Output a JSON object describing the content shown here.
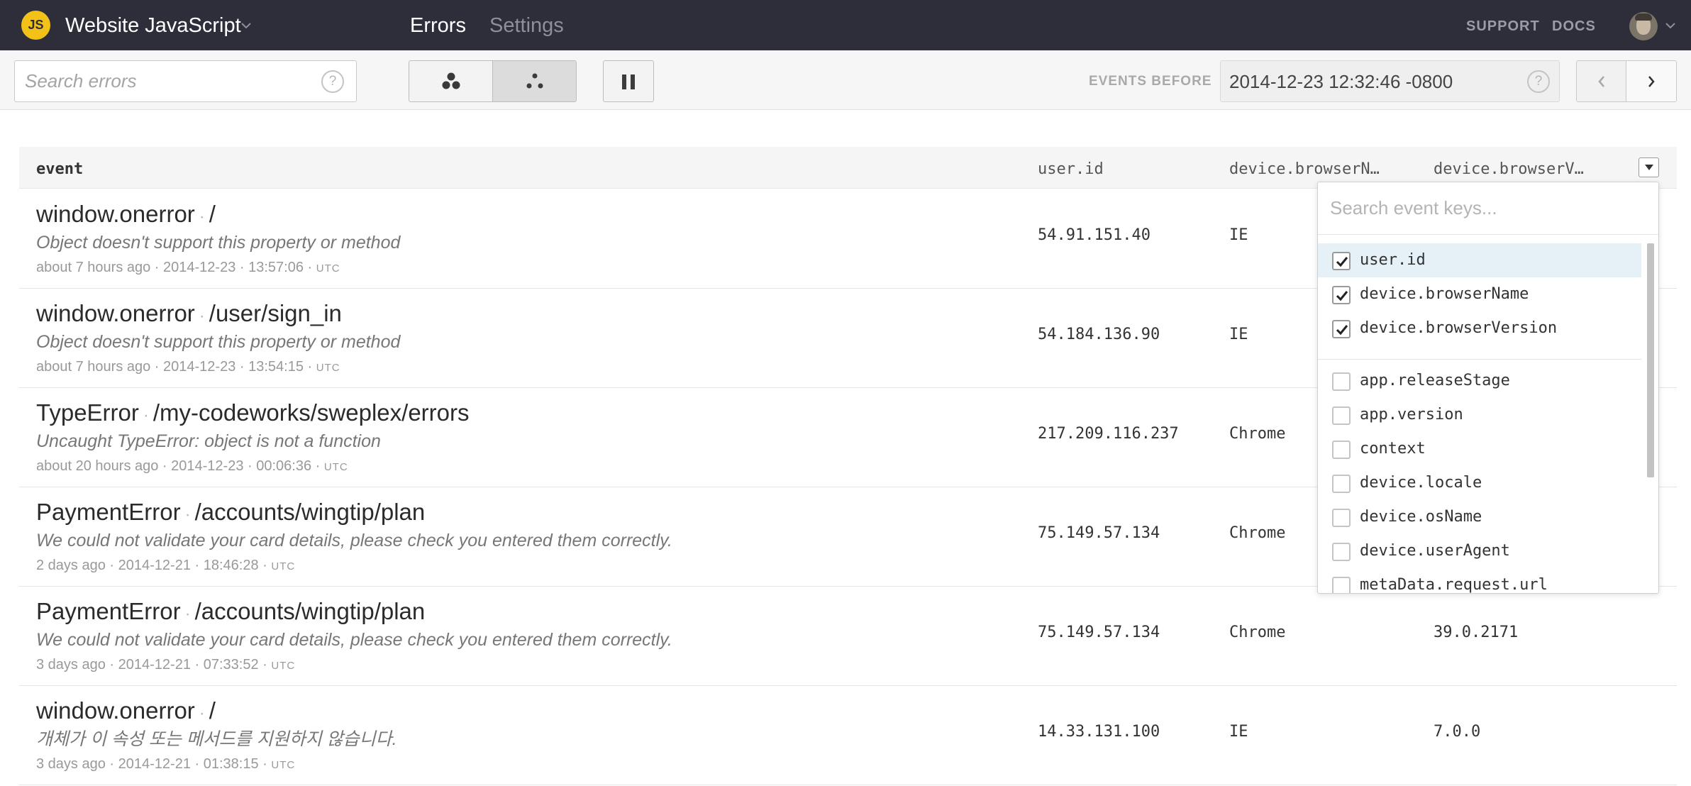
{
  "nav": {
    "logo_text": "JS",
    "project_name": "Website JavaScript",
    "tabs": [
      {
        "label": "Errors",
        "active": true
      },
      {
        "label": "Settings",
        "active": false
      }
    ],
    "links": [
      "SUPPORT",
      "DOCS"
    ]
  },
  "toolbar": {
    "search_placeholder": "Search errors",
    "events_before_label": "EVENTS BEFORE",
    "events_before_value": "2014-12-23 12:32:46 -0800",
    "help_glyph": "?"
  },
  "table": {
    "headers": [
      "event",
      "user.id",
      "device.browserN…",
      "device.browserV…"
    ],
    "rows": [
      {
        "error_class": "window.onerror",
        "context": "/",
        "message": "Object doesn't support this property or method",
        "relative_time": "about 7 hours ago",
        "date": "2014-12-23",
        "time": "13:57:06",
        "tz": "UTC",
        "user_id": "54.91.151.40",
        "browser_name": "IE",
        "browser_version": ""
      },
      {
        "error_class": "window.onerror",
        "context": "/user/sign_in",
        "message": "Object doesn't support this property or method",
        "relative_time": "about 7 hours ago",
        "date": "2014-12-23",
        "time": "13:54:15",
        "tz": "UTC",
        "user_id": "54.184.136.90",
        "browser_name": "IE",
        "browser_version": ""
      },
      {
        "error_class": "TypeError",
        "context": "/my-codeworks/sweplex/errors",
        "message": "Uncaught TypeError: object is not a function",
        "relative_time": "about 20 hours ago",
        "date": "2014-12-23",
        "time": "00:06:36",
        "tz": "UTC",
        "user_id": "217.209.116.237",
        "browser_name": "Chrome",
        "browser_version": ""
      },
      {
        "error_class": "PaymentError",
        "context": "/accounts/wingtip/plan",
        "message": "We could not validate your card details, please check you entered them correctly.",
        "relative_time": "2 days ago",
        "date": "2014-12-21",
        "time": "18:46:28",
        "tz": "UTC",
        "user_id": "75.149.57.134",
        "browser_name": "Chrome",
        "browser_version": ""
      },
      {
        "error_class": "PaymentError",
        "context": "/accounts/wingtip/plan",
        "message": "We could not validate your card details, please check you entered them correctly.",
        "relative_time": "3 days ago",
        "date": "2014-12-21",
        "time": "07:33:52",
        "tz": "UTC",
        "user_id": "75.149.57.134",
        "browser_name": "Chrome",
        "browser_version": "39.0.2171"
      },
      {
        "error_class": "window.onerror",
        "context": "/",
        "message": "개체가 이 속성 또는 메서드를 지원하지 않습니다.",
        "relative_time": "3 days ago",
        "date": "2014-12-21",
        "time": "01:38:15",
        "tz": "UTC",
        "user_id": "14.33.131.100",
        "browser_name": "IE",
        "browser_version": "7.0.0"
      }
    ]
  },
  "column_picker": {
    "search_placeholder": "Search event keys...",
    "keys": [
      {
        "label": "user.id",
        "checked": true
      },
      {
        "label": "device.browserName",
        "checked": true
      },
      {
        "label": "device.browserVersion",
        "checked": true
      },
      {
        "label": "app.releaseStage",
        "checked": false
      },
      {
        "label": "app.version",
        "checked": false
      },
      {
        "label": "context",
        "checked": false
      },
      {
        "label": "device.locale",
        "checked": false
      },
      {
        "label": "device.osName",
        "checked": false
      },
      {
        "label": "device.userAgent",
        "checked": false
      },
      {
        "label": "metaData.request.url",
        "checked": false
      }
    ]
  },
  "colors": {
    "nav_background": "#2d2e3a",
    "logo_yellow": "#f3c219",
    "highlight_row": "#e6f1f7"
  },
  "icons": [
    "chevron-down-icon",
    "help-icon",
    "cluster-icon",
    "pause-icon",
    "chevron-left-icon",
    "chevron-right-icon",
    "checkmark-icon",
    "avatar"
  ]
}
